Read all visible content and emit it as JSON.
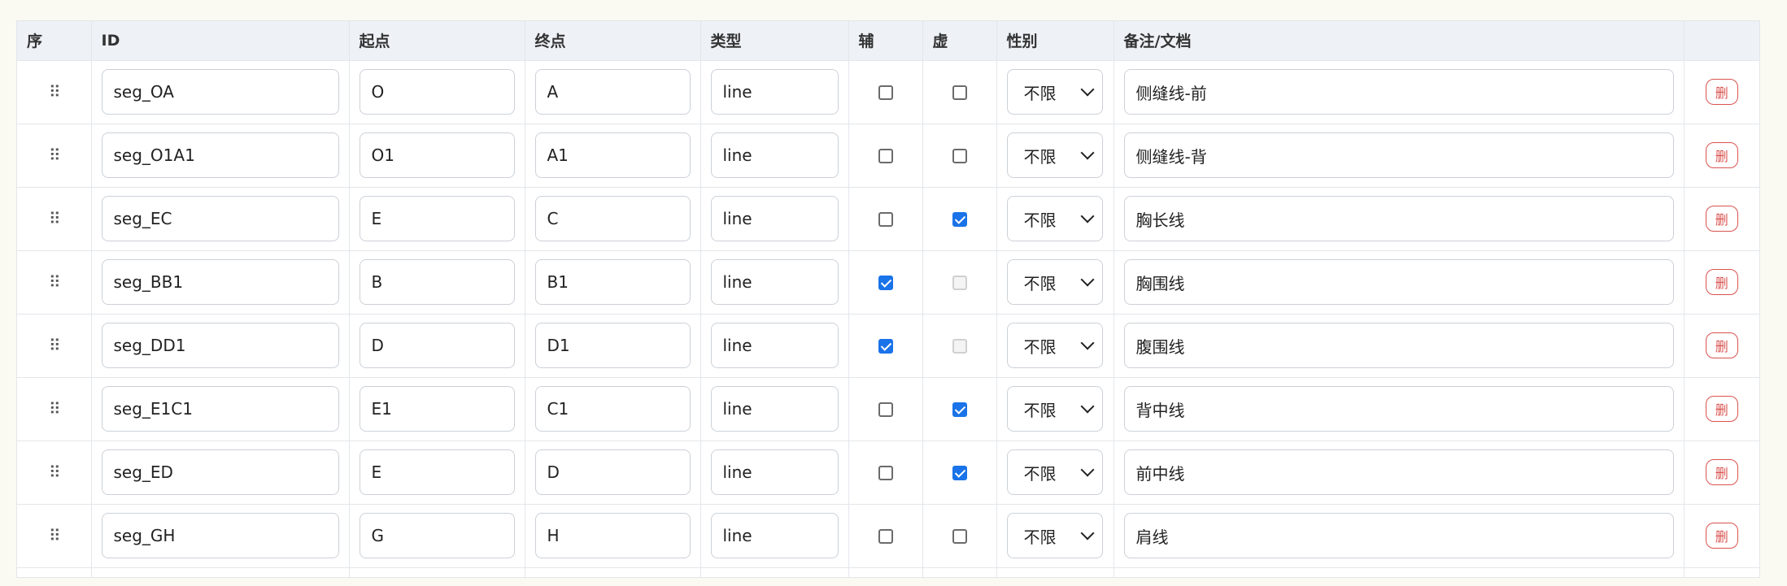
{
  "table": {
    "headers": {
      "seq": "序",
      "id": "ID",
      "start": "起点",
      "end": "终点",
      "type": "类型",
      "aux": "辅",
      "dashed": "虚",
      "gender": "性别",
      "notes": "备注/文档",
      "actions": ""
    },
    "drag_glyph": "⠿",
    "delete_label": "删",
    "rows": [
      {
        "id": "seg_OA",
        "start": "O",
        "end": "A",
        "type": "line",
        "aux": false,
        "dashed": false,
        "dashed_disabled": false,
        "gender": "不限",
        "notes": "侧缝线-前"
      },
      {
        "id": "seg_O1A1",
        "start": "O1",
        "end": "A1",
        "type": "line",
        "aux": false,
        "dashed": false,
        "dashed_disabled": false,
        "gender": "不限",
        "notes": "侧缝线-背"
      },
      {
        "id": "seg_EC",
        "start": "E",
        "end": "C",
        "type": "line",
        "aux": false,
        "dashed": true,
        "dashed_disabled": false,
        "gender": "不限",
        "notes": "胸长线"
      },
      {
        "id": "seg_BB1",
        "start": "B",
        "end": "B1",
        "type": "line",
        "aux": true,
        "dashed": false,
        "dashed_disabled": true,
        "gender": "不限",
        "notes": "胸围线"
      },
      {
        "id": "seg_DD1",
        "start": "D",
        "end": "D1",
        "type": "line",
        "aux": true,
        "dashed": false,
        "dashed_disabled": true,
        "gender": "不限",
        "notes": "腹围线"
      },
      {
        "id": "seg_E1C1",
        "start": "E1",
        "end": "C1",
        "type": "line",
        "aux": false,
        "dashed": true,
        "dashed_disabled": false,
        "gender": "不限",
        "notes": "背中线"
      },
      {
        "id": "seg_ED",
        "start": "E",
        "end": "D",
        "type": "line",
        "aux": false,
        "dashed": true,
        "dashed_disabled": false,
        "gender": "不限",
        "notes": "前中线"
      },
      {
        "id": "seg_GH",
        "start": "G",
        "end": "H",
        "type": "line",
        "aux": false,
        "dashed": false,
        "dashed_disabled": false,
        "gender": "不限",
        "notes": "肩线"
      }
    ]
  }
}
